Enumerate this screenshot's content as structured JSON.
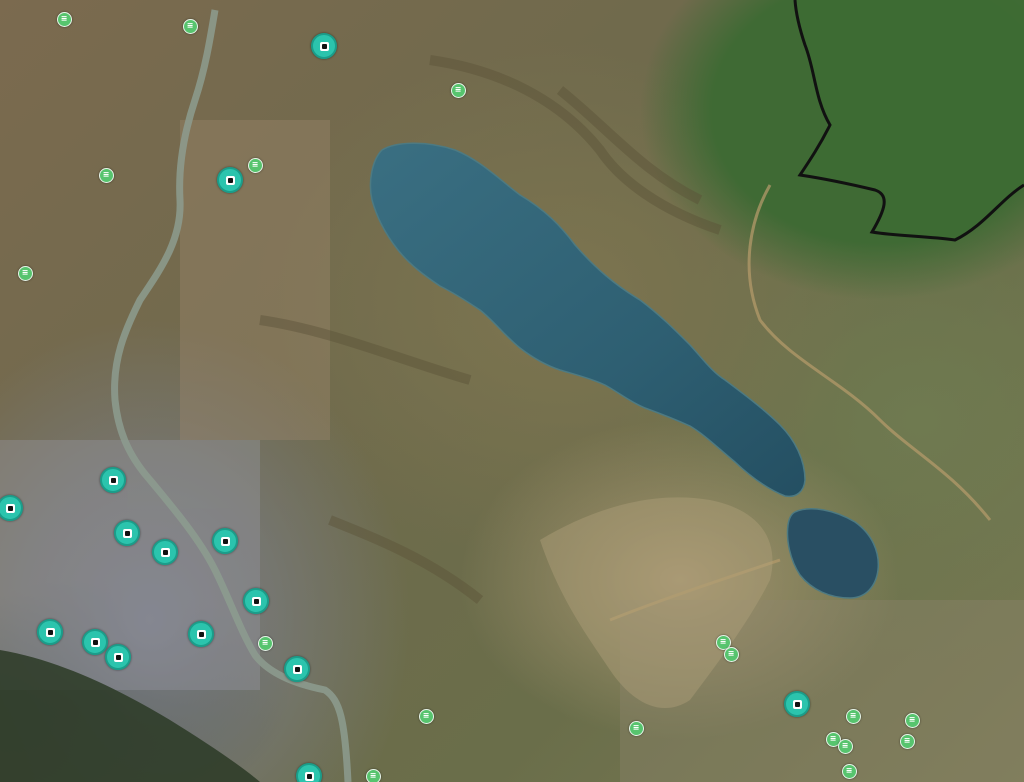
{
  "map": {
    "basemap": "satellite",
    "features": {
      "water": [
        "lake-main",
        "lake-small",
        "river"
      ],
      "boundary": "park-boundary"
    },
    "colors": {
      "water": "#2f5f72",
      "river": "#8a9a8a",
      "forest": "#3f6a34",
      "boundary": "#111111",
      "station_marker": "#2bc4ad",
      "poi_marker": "#57c46e"
    }
  },
  "markers": {
    "stations": [
      {
        "id": "station-1",
        "icon": "transit-station-icon"
      },
      {
        "id": "station-2",
        "icon": "transit-station-icon"
      },
      {
        "id": "station-3",
        "icon": "transit-station-icon"
      },
      {
        "id": "station-4",
        "icon": "transit-station-icon"
      },
      {
        "id": "station-5",
        "icon": "transit-station-icon"
      },
      {
        "id": "station-6",
        "icon": "transit-station-icon"
      },
      {
        "id": "station-7",
        "icon": "transit-station-icon"
      },
      {
        "id": "station-8",
        "icon": "transit-station-icon"
      },
      {
        "id": "station-9",
        "icon": "transit-station-icon"
      },
      {
        "id": "station-10",
        "icon": "transit-station-icon"
      },
      {
        "id": "station-11",
        "icon": "transit-station-icon"
      },
      {
        "id": "station-12",
        "icon": "transit-station-icon"
      },
      {
        "id": "station-13",
        "icon": "transit-station-icon"
      },
      {
        "id": "station-14",
        "icon": "transit-station-icon"
      },
      {
        "id": "station-15",
        "icon": "transit-station-icon"
      }
    ],
    "pois": [
      {
        "id": "poi-1",
        "icon": "poi-icon"
      },
      {
        "id": "poi-2",
        "icon": "poi-icon"
      },
      {
        "id": "poi-3",
        "icon": "poi-icon"
      },
      {
        "id": "poi-4",
        "icon": "poi-icon"
      },
      {
        "id": "poi-5",
        "icon": "poi-icon"
      },
      {
        "id": "poi-6",
        "icon": "poi-icon"
      },
      {
        "id": "poi-7",
        "icon": "poi-icon"
      },
      {
        "id": "poi-8",
        "icon": "poi-icon"
      },
      {
        "id": "poi-9",
        "icon": "poi-icon"
      },
      {
        "id": "poi-10",
        "icon": "poi-icon"
      },
      {
        "id": "poi-11",
        "icon": "poi-icon"
      },
      {
        "id": "poi-12",
        "icon": "poi-icon"
      },
      {
        "id": "poi-13",
        "icon": "poi-icon"
      },
      {
        "id": "poi-14",
        "icon": "poi-icon"
      },
      {
        "id": "poi-15",
        "icon": "poi-icon"
      },
      {
        "id": "poi-16",
        "icon": "poi-icon"
      },
      {
        "id": "poi-17",
        "icon": "poi-icon"
      },
      {
        "id": "poi-18",
        "icon": "poi-icon"
      }
    ]
  }
}
